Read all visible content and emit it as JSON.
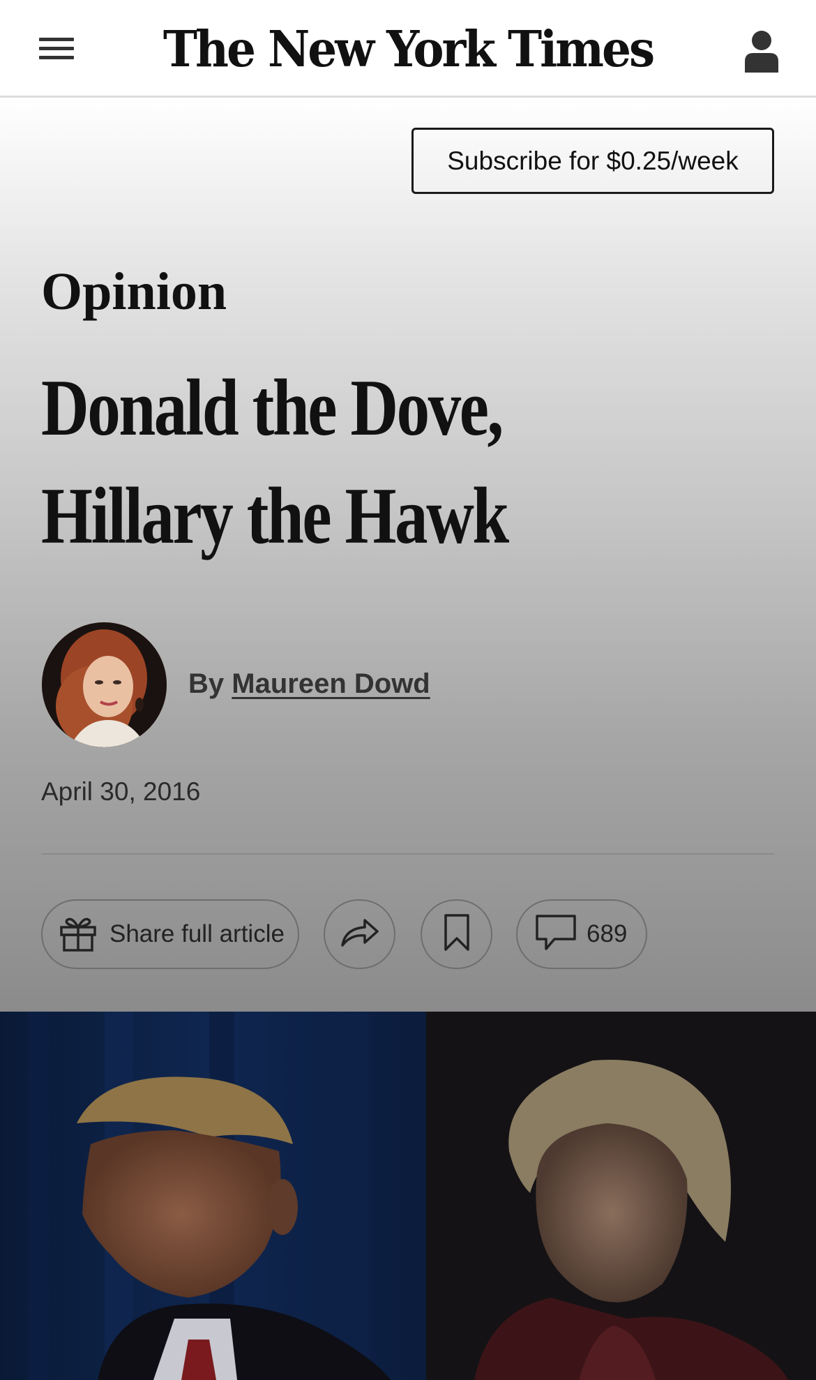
{
  "header": {
    "logo_text": "The New York Times",
    "menu_icon": "hamburger-menu-icon",
    "account_icon": "user-account-icon"
  },
  "subscribe": {
    "label": "Subscribe for $0.25/week"
  },
  "article": {
    "section": "Opinion",
    "headline_lines": [
      "Donald the Dove,",
      "Hillary the Hawk"
    ],
    "byline_prefix": "By",
    "author": "Maureen Dowd",
    "date": "April 30, 2016"
  },
  "actions": {
    "share_full_label": "Share full article",
    "share_full_icon": "gift-icon",
    "share_icon": "share-arrow-icon",
    "save_icon": "bookmark-icon",
    "comments_icon": "comment-bubble-icon",
    "comments_count": "689"
  },
  "colors": {
    "text": "#121212",
    "header_border": "#dcdcdc",
    "pill_border": "#6e6e6e"
  }
}
